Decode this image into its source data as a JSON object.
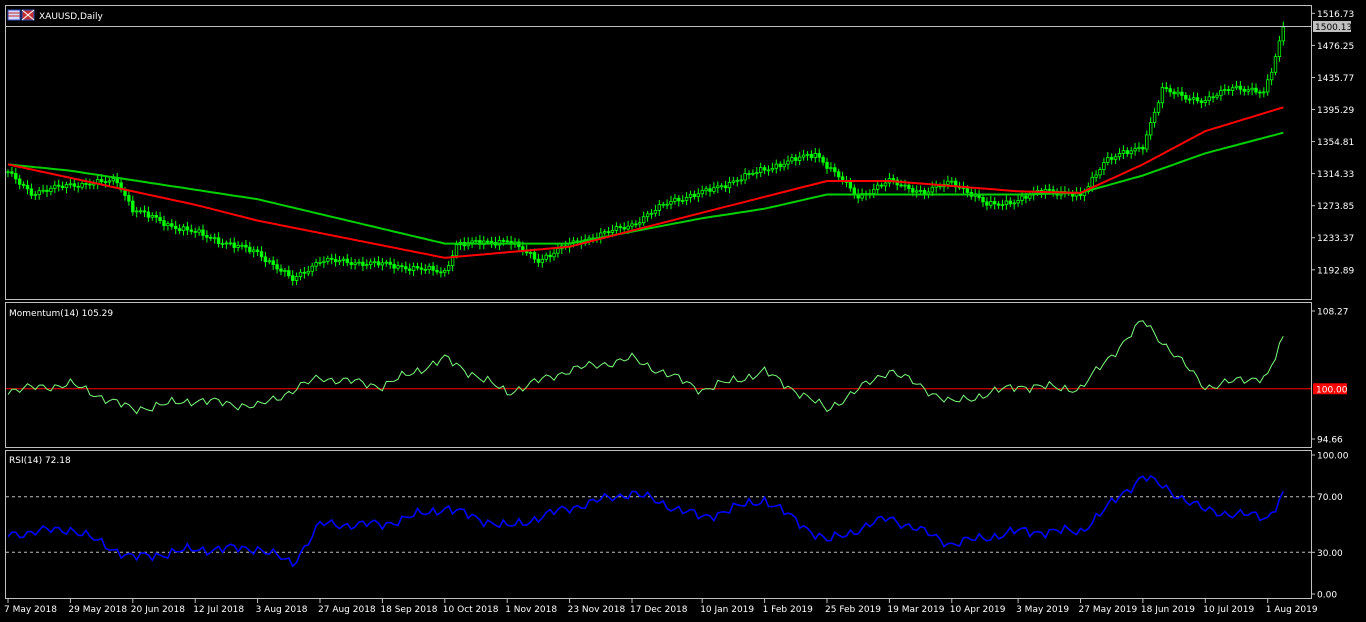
{
  "window": {
    "symbol_title": "XAUUSD,Daily",
    "current_price": "1500.13"
  },
  "colors": {
    "background": "#000000",
    "frame": "#c0c0c0",
    "bull_candle": "#00ff00",
    "ma_fast": "#ff0000",
    "ma_slow": "#00d000",
    "momentum_line": "#7cfc7c",
    "momentum_level": "#ff0000",
    "rsi_line": "#0000ff",
    "rsi_levels": "#c0c0c0",
    "price_tag_bg": "#c0c0c0",
    "level_tag_bg": "#ff0000"
  },
  "chart_data": [
    {
      "type": "candlestick",
      "panel": "price",
      "symbol": "XAUUSD",
      "timeframe": "Daily",
      "y_ticks": [
        1516.73,
        1476.25,
        1435.77,
        1395.29,
        1354.81,
        1314.33,
        1273.85,
        1233.37,
        1192.89
      ],
      "ylim": [
        1156,
        1526
      ],
      "x_tick_labels": [
        "7 May 2018",
        "29 May 2018",
        "20 Jun 2018",
        "12 Jul 2018",
        "3 Aug 2018",
        "27 Aug 2018",
        "18 Sep 2018",
        "10 Oct 2018",
        "1 Nov 2018",
        "23 Nov 2018",
        "17 Dec 2018",
        "10 Jan 2019",
        "1 Feb 2019",
        "25 Feb 2019",
        "19 Mar 2019",
        "10 Apr 2019",
        "3 May 2019",
        "27 May 2019",
        "18 Jun 2019",
        "10 Jul 2019",
        "1 Aug 2019"
      ],
      "close_anchors": [
        [
          "7 May 2018",
          1315
        ],
        [
          "15 May 2018",
          1290
        ],
        [
          "29 May 2018",
          1300
        ],
        [
          "14 Jun 2018",
          1305
        ],
        [
          "20 Jun 2018",
          1270
        ],
        [
          "3 Jul 2018",
          1250
        ],
        [
          "12 Jul 2018",
          1240
        ],
        [
          "25 Jul 2018",
          1225
        ],
        [
          "3 Aug 2018",
          1215
        ],
        [
          "16 Aug 2018",
          1180
        ],
        [
          "27 Aug 2018",
          1205
        ],
        [
          "18 Sep 2018",
          1200
        ],
        [
          "10 Oct 2018",
          1190
        ],
        [
          "15 Oct 2018",
          1225
        ],
        [
          "1 Nov 2018",
          1230
        ],
        [
          "13 Nov 2018",
          1205
        ],
        [
          "23 Nov 2018",
          1225
        ],
        [
          "17 Dec 2018",
          1250
        ],
        [
          "31 Dec 2018",
          1280
        ],
        [
          "10 Jan 2019",
          1290
        ],
        [
          "1 Feb 2019",
          1320
        ],
        [
          "20 Feb 2019",
          1340
        ],
        [
          "25 Feb 2019",
          1325
        ],
        [
          "7 Mar 2019",
          1285
        ],
        [
          "19 Mar 2019",
          1305
        ],
        [
          "1 Apr 2019",
          1290
        ],
        [
          "10 Apr 2019",
          1305
        ],
        [
          "23 Apr 2019",
          1275
        ],
        [
          "3 May 2019",
          1280
        ],
        [
          "14 May 2019",
          1295
        ],
        [
          "27 May 2019",
          1285
        ],
        [
          "4 Jun 2019",
          1330
        ],
        [
          "14 Jun 2019",
          1345
        ],
        [
          "18 Jun 2019",
          1350
        ],
        [
          "25 Jun 2019",
          1420
        ],
        [
          "10 Jul 2019",
          1405
        ],
        [
          "19 Jul 2019",
          1425
        ],
        [
          "31 Jul 2019",
          1415
        ],
        [
          "2 Aug 2019",
          1445
        ],
        [
          "7 Aug 2019",
          1500
        ]
      ],
      "ma_fast_anchors": [
        [
          "7 May 2018",
          1326
        ],
        [
          "12 Jul 2018",
          1275
        ],
        [
          "3 Aug 2018",
          1255
        ],
        [
          "10 Oct 2018",
          1208
        ],
        [
          "1 Nov 2018",
          1215
        ],
        [
          "23 Nov 2018",
          1222
        ],
        [
          "10 Jan 2019",
          1265
        ],
        [
          "25 Feb 2019",
          1305
        ],
        [
          "19 Mar 2019",
          1305
        ],
        [
          "3 May 2019",
          1292
        ],
        [
          "27 May 2019",
          1290
        ],
        [
          "18 Jun 2019",
          1326
        ],
        [
          "10 Jul 2019",
          1368
        ],
        [
          "7 Aug 2019",
          1398
        ]
      ],
      "ma_slow_anchors": [
        [
          "7 May 2018",
          1326
        ],
        [
          "29 May 2018",
          1318
        ],
        [
          "3 Aug 2018",
          1282
        ],
        [
          "10 Oct 2018",
          1226
        ],
        [
          "23 Nov 2018",
          1226
        ],
        [
          "10 Jan 2019",
          1258
        ],
        [
          "1 Feb 2019",
          1270
        ],
        [
          "25 Feb 2019",
          1288
        ],
        [
          "3 May 2019",
          1288
        ],
        [
          "27 May 2019",
          1290
        ],
        [
          "18 Jun 2019",
          1312
        ],
        [
          "10 Jul 2019",
          1340
        ],
        [
          "7 Aug 2019",
          1366
        ]
      ]
    },
    {
      "type": "line",
      "panel": "momentum",
      "title": "Momentum(14) 105.29",
      "y_ticks": [
        108.27,
        94.66
      ],
      "ylim": [
        94.66,
        108.27
      ],
      "level": 100.0,
      "level_label": "100.00",
      "series": [
        {
          "name": "Momentum(14)",
          "anchors": [
            [
              "7 May 2018",
              99.8
            ],
            [
              "29 May 2018",
              100.5
            ],
            [
              "20 Jun 2018",
              97.8
            ],
            [
              "12 Jul 2018",
              98.8
            ],
            [
              "3 Aug 2018",
              98.1
            ],
            [
              "27 Aug 2018",
              101.2
            ],
            [
              "18 Sep 2018",
              100.3
            ],
            [
              "10 Oct 2018",
              103.2
            ],
            [
              "1 Nov 2018",
              99.6
            ],
            [
              "23 Nov 2018",
              102.0
            ],
            [
              "17 Dec 2018",
              103.2
            ],
            [
              "10 Jan 2019",
              99.9
            ],
            [
              "1 Feb 2019",
              101.8
            ],
            [
              "25 Feb 2019",
              97.8
            ],
            [
              "19 Mar 2019",
              102.0
            ],
            [
              "10 Apr 2019",
              98.5
            ],
            [
              "3 May 2019",
              100.3
            ],
            [
              "27 May 2019",
              100.0
            ],
            [
              "18 Jun 2019",
              107.2
            ],
            [
              "10 Jul 2019",
              100.2
            ],
            [
              "1 Aug 2019",
              101.4
            ],
            [
              "7 Aug 2019",
              105.29
            ]
          ]
        }
      ]
    },
    {
      "type": "line",
      "panel": "rsi",
      "title": "RSI(14) 72.18",
      "y_ticks": [
        100.0,
        70.0,
        30.0,
        0.0
      ],
      "y_tick_labels": [
        "100.00",
        "70.00",
        "30.00",
        "0.00"
      ],
      "ylim": [
        0,
        100
      ],
      "levels": [
        70,
        30
      ],
      "series": [
        {
          "name": "RSI(14)",
          "anchors": [
            [
              "7 May 2018",
              43
            ],
            [
              "29 May 2018",
              47
            ],
            [
              "20 Jun 2018",
              26
            ],
            [
              "12 Jul 2018",
              32
            ],
            [
              "3 Aug 2018",
              33
            ],
            [
              "16 Aug 2018",
              22
            ],
            [
              "27 Aug 2018",
              50
            ],
            [
              "18 Sep 2018",
              50
            ],
            [
              "10 Oct 2018",
              62
            ],
            [
              "1 Nov 2018",
              48
            ],
            [
              "23 Nov 2018",
              62
            ],
            [
              "17 Dec 2018",
              73
            ],
            [
              "10 Jan 2019",
              55
            ],
            [
              "1 Feb 2019",
              68
            ],
            [
              "25 Feb 2019",
              38
            ],
            [
              "19 Mar 2019",
              55
            ],
            [
              "10 Apr 2019",
              36
            ],
            [
              "3 May 2019",
              45
            ],
            [
              "27 May 2019",
              45
            ],
            [
              "18 Jun 2019",
              85
            ],
            [
              "10 Jul 2019",
              60
            ],
            [
              "1 Aug 2019",
              55
            ],
            [
              "7 Aug 2019",
              72.18
            ]
          ]
        }
      ]
    }
  ]
}
